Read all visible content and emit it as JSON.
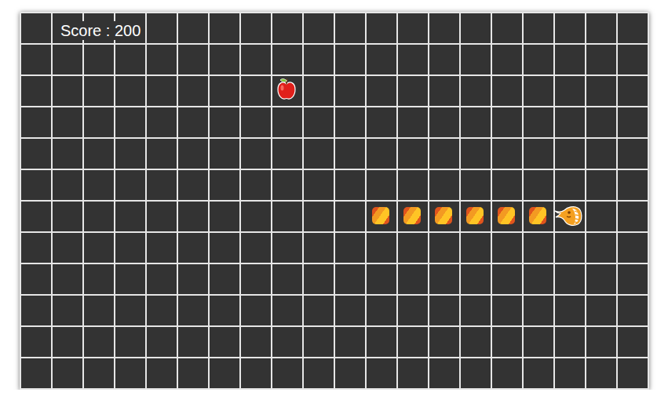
{
  "score": {
    "text": "Score : 200"
  },
  "board": {
    "columns": 20,
    "rows": 12
  },
  "apple": {
    "col": 8,
    "row": 2
  },
  "snake": {
    "segments": [
      {
        "col": 17,
        "row": 6,
        "kind": "head"
      },
      {
        "col": 16,
        "row": 6,
        "kind": "body"
      },
      {
        "col": 15,
        "row": 6,
        "kind": "body"
      },
      {
        "col": 14,
        "row": 6,
        "kind": "body"
      },
      {
        "col": 13,
        "row": 6,
        "kind": "body"
      },
      {
        "col": 12,
        "row": 6,
        "kind": "body"
      },
      {
        "col": 11,
        "row": 6,
        "kind": "body"
      }
    ]
  }
}
